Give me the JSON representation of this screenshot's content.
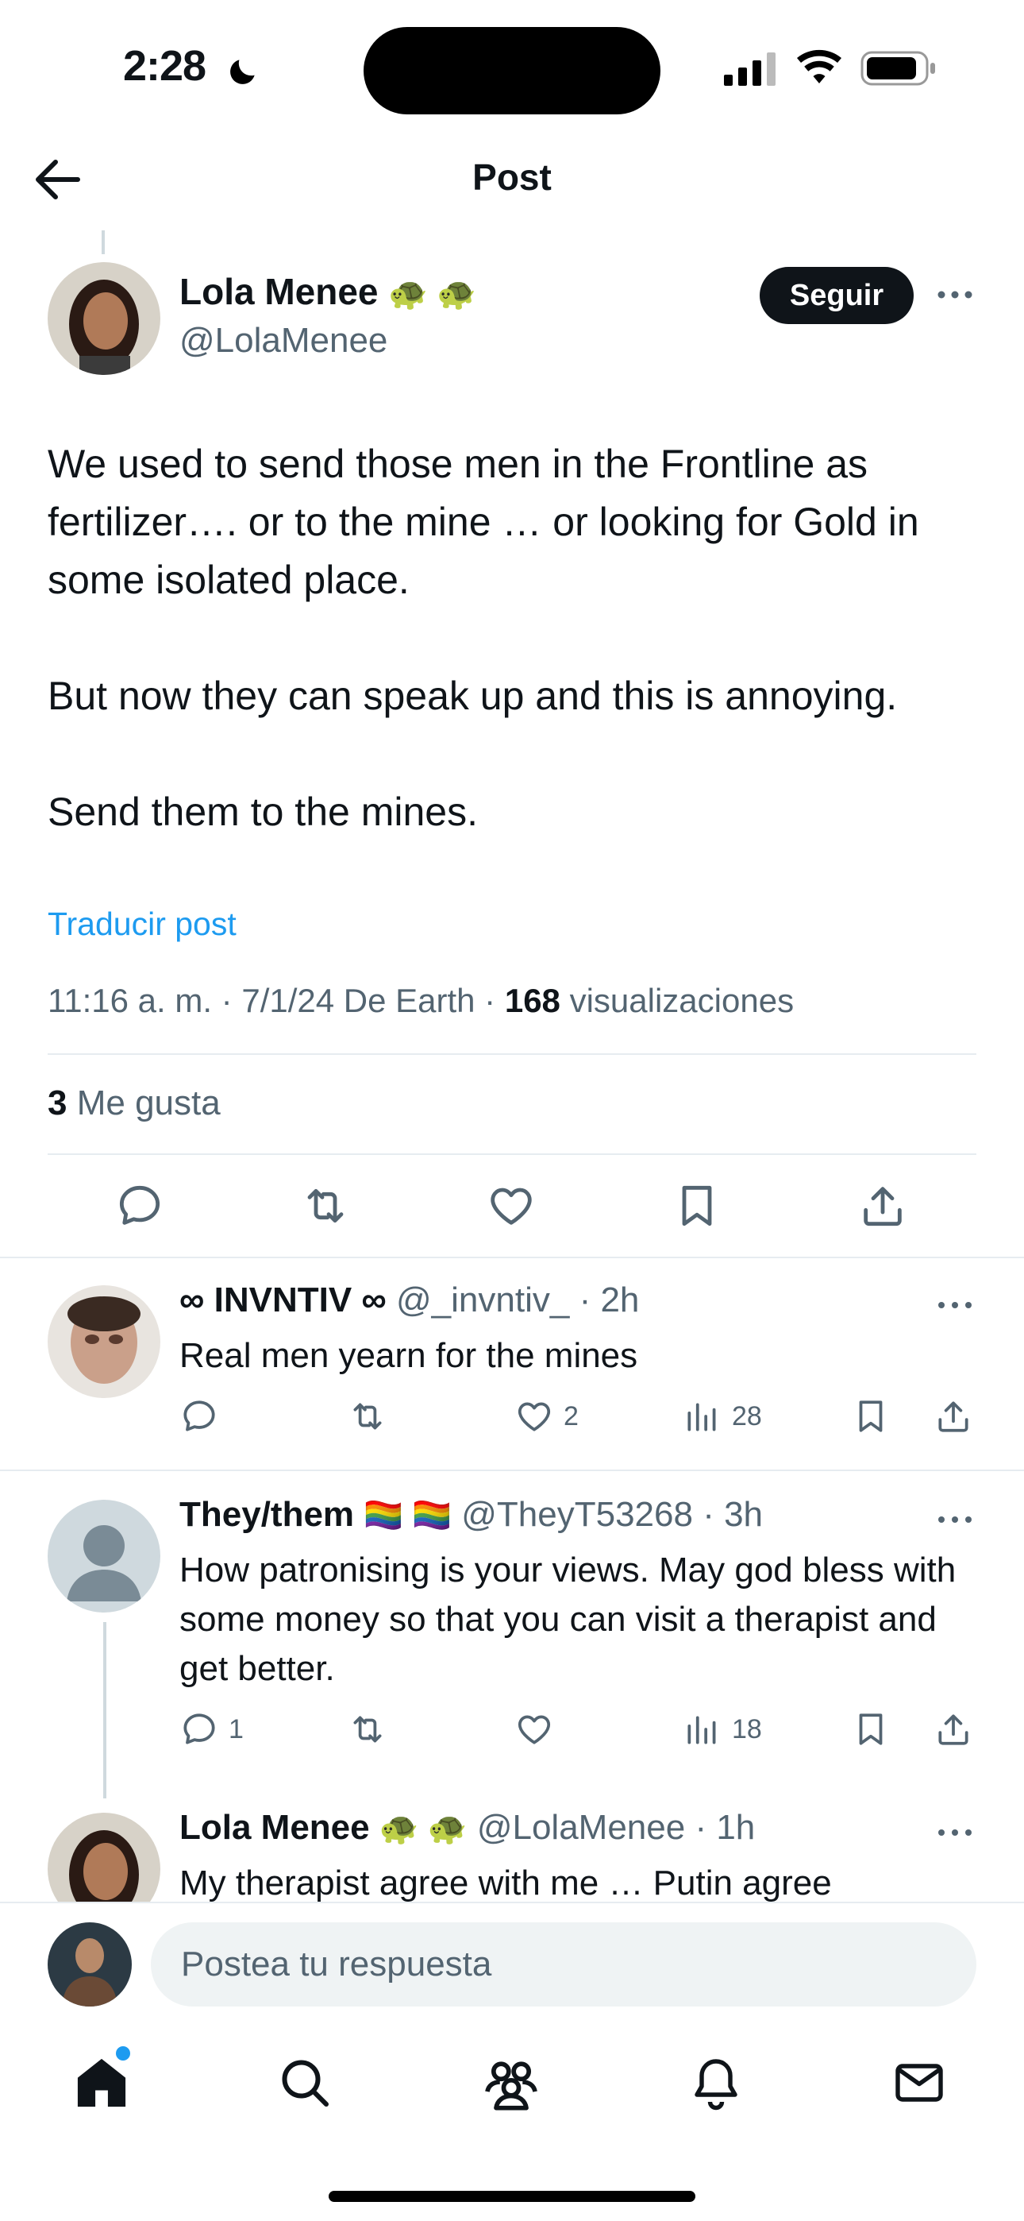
{
  "status_bar": {
    "time": "2:28"
  },
  "header": {
    "title": "Post"
  },
  "main_post": {
    "name": "Lola Menee",
    "name_emoji": "🐢 🐢",
    "handle": "@LolaMenee",
    "follow_label": "Seguir",
    "text": [
      "We used to send those men in the Frontline as fertilizer…. or to the mine … or looking for Gold in some isolated place.",
      "",
      "But now they can speak up and this is annoying.",
      "",
      "Send them to the mines."
    ],
    "translate_label": "Traducir post",
    "meta_prefix": "11:16 a. m. · 7/1/24 De Earth · ",
    "views_count": "168",
    "views_label": "visualizaciones",
    "likes_count": "3",
    "likes_label": "Me gusta"
  },
  "replies": [
    {
      "name": "∞ INVNTIV ∞",
      "handle": "@_invntiv_",
      "time": "· 2h",
      "text": "Real men yearn for the mines",
      "replies": "",
      "likes": "2",
      "views": "28"
    },
    {
      "name": "They/them",
      "name_emoji": "🏳️‍🌈 🏳️‍🌈",
      "handle": "@TheyT53268",
      "time": "· 3h",
      "text": "How patronising is your views. May god bless with some money so that you can visit a therapist and get better.",
      "replies": "1",
      "likes": "",
      "views": "18"
    },
    {
      "name": "Lola Menee",
      "name_emoji": "🐢 🐢",
      "handle": "@LolaMenee",
      "time": "· 1h",
      "text": "My therapist agree with me … Putin agree"
    }
  ],
  "reply_bar": {
    "placeholder": "Postea tu respuesta"
  },
  "colors": {
    "accent": "#1d9bf0",
    "text": "#0f1419",
    "muted": "#536471",
    "notification_dot": "#1d9bf0"
  }
}
